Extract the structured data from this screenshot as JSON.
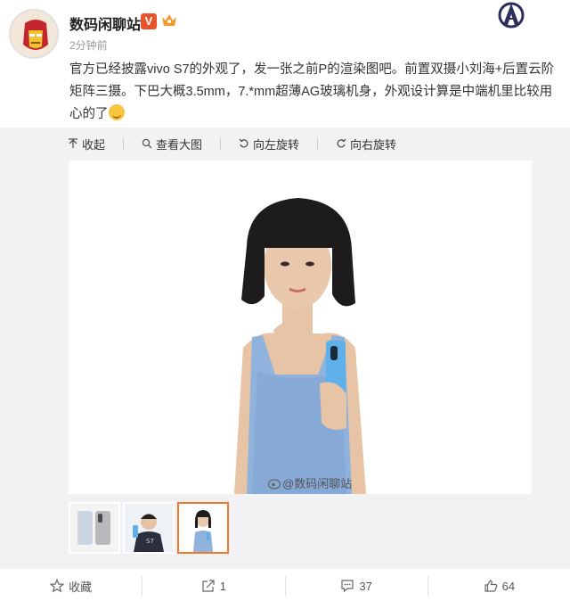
{
  "user": {
    "name": "数码闲聊站",
    "verified_mark": "V",
    "timestamp": "2分钟前"
  },
  "post": {
    "text": "官方已经披露vivo S7的外观了，发一张之前P的渲染图吧。前置双摄小刘海+后置云阶矩阵三摄。下巴大概3.5mm，7.*mm超薄AG玻璃机身，外观设计算是中端机里比较用心的了"
  },
  "media_toolbar": {
    "collapse": "收起",
    "view_large": "查看大图",
    "rotate_left": "向左旋转",
    "rotate_right": "向右旋转"
  },
  "image": {
    "watermark": "@数码闲聊站"
  },
  "actions": {
    "favorite": "收藏",
    "share_count": "1",
    "comment_count": "37",
    "like_count": "64"
  },
  "colors": {
    "accent_orange": "#f07a2a",
    "verified_red": "#e8532a",
    "dress_blue": "#8fb3dd",
    "phone_blue": "#5fb0e8"
  }
}
